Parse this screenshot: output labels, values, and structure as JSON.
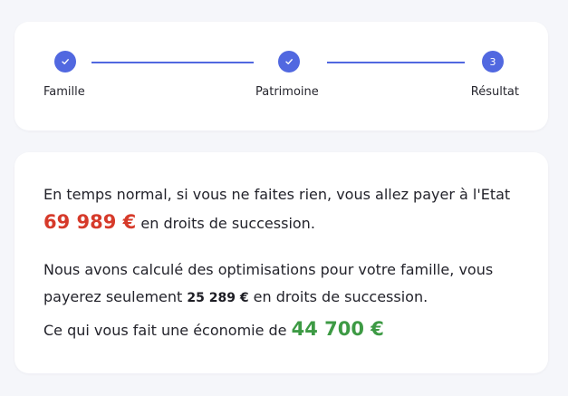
{
  "colors": {
    "accent": "#5168e0",
    "penalty": "#d63a2a",
    "saving": "#3d9a44",
    "background": "#f5f6fa",
    "card": "#ffffff"
  },
  "stepper": {
    "steps": [
      {
        "label": "Famille",
        "state": "completed",
        "icon": "check-icon"
      },
      {
        "label": "Patrimoine",
        "state": "completed",
        "icon": "check-icon"
      },
      {
        "label": "Résultat",
        "state": "current",
        "number": "3"
      }
    ]
  },
  "result": {
    "p1": {
      "before": "En temps normal, si vous ne faites rien, vous allez payer à l'Etat ",
      "amount": "69 989 €",
      "after": " en droits de succession."
    },
    "p2": {
      "before": "Nous avons calculé des optimisations pour votre famille, vous payerez seulement ",
      "amount": "25 289 €",
      "after": " en droits de succession."
    },
    "p3": {
      "before": "Ce qui vous fait une économie de ",
      "amount": "44 700 €"
    }
  }
}
